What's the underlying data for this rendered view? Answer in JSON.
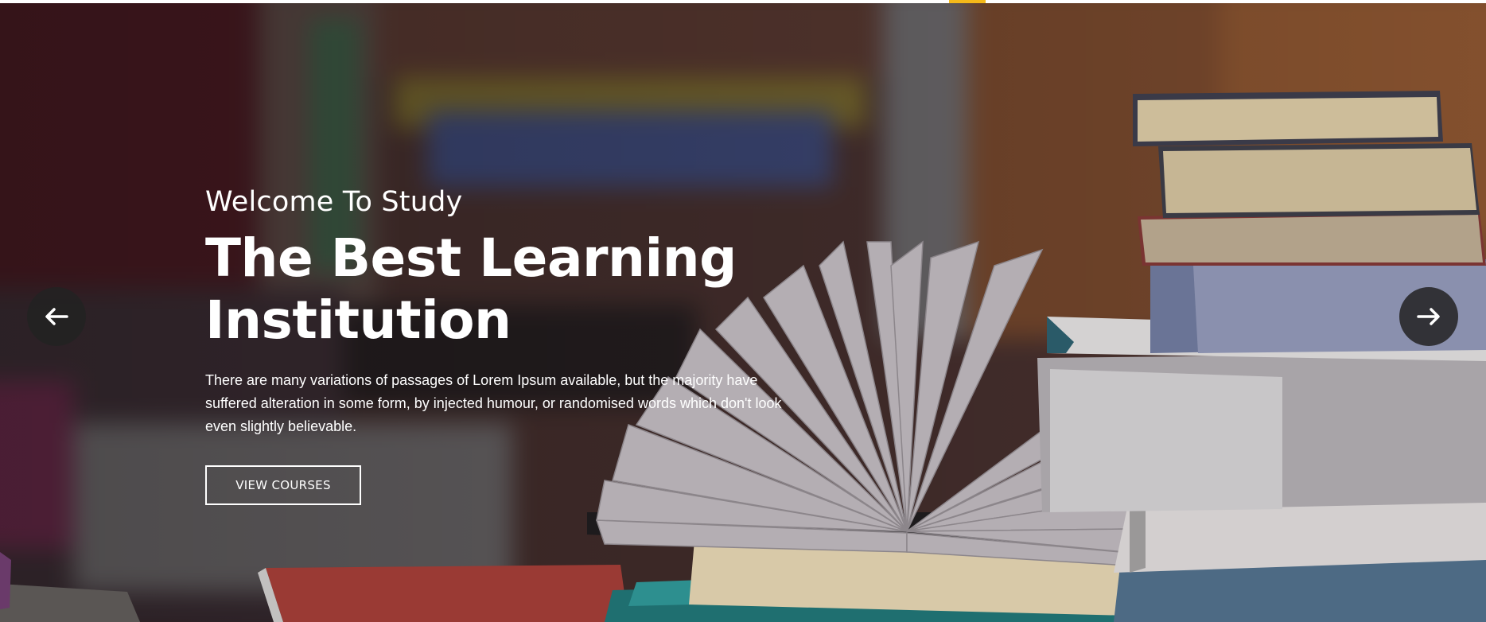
{
  "hero": {
    "eyebrow": "Welcome To Study",
    "headline": "The Best Learning Institution",
    "lead": "There are many variations of passages of Lorem Ipsum available, but the majority have suffered alteration in some form, by injected humour, or randomised words which don't look even slightly believable.",
    "cta_label": "VIEW COURSES"
  },
  "slider": {
    "prev_icon": "arrow-left-icon",
    "next_icon": "arrow-right-icon"
  },
  "colors": {
    "accent": "#f4b919",
    "text": "#ffffff",
    "arrow_bg": "#222222"
  }
}
